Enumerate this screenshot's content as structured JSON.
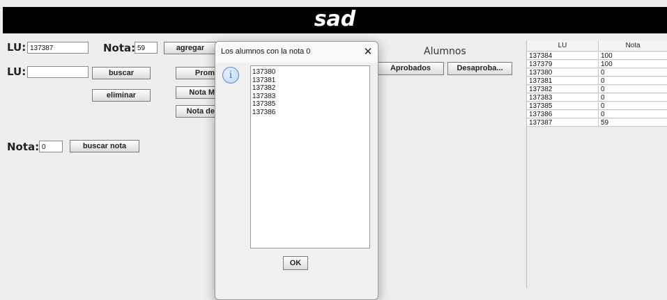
{
  "app": {
    "title": "sad"
  },
  "form": {
    "lu_label": "LU:",
    "lu_value": "137387",
    "nota_label": "Nota:",
    "nota_value": "59",
    "agregar_label": "agregar",
    "lu2_label": "LU:",
    "lu2_value": "",
    "buscar_label": "buscar",
    "eliminar_label": "eliminar",
    "promedio_label": "Prom",
    "nota_max_label": "Nota M",
    "nota_de_label": "Nota de",
    "nota3_label": "Nota:",
    "nota3_value": "0",
    "buscar_nota_label": "buscar nota"
  },
  "alumnos": {
    "label": "Alumnos",
    "aprobados_label": "Aprobados",
    "desaprobados_label": "Desaproba..."
  },
  "table": {
    "headers": [
      "LU",
      "Nota"
    ],
    "rows": [
      [
        "137384",
        "100"
      ],
      [
        "137379",
        "100"
      ],
      [
        "137380",
        "0"
      ],
      [
        "137381",
        "0"
      ],
      [
        "137382",
        "0"
      ],
      [
        "137383",
        "0"
      ],
      [
        "137385",
        "0"
      ],
      [
        "137386",
        "0"
      ],
      [
        "137387",
        "59"
      ]
    ]
  },
  "dialog": {
    "title": "Los alumnos con la nota 0",
    "close_glyph": "✕",
    "icon_glyph": "i",
    "items": [
      "137380",
      "137381",
      "137382",
      "137383",
      "137385",
      "137386"
    ],
    "ok_label": "OK"
  },
  "icons": {
    "info": "info-icon",
    "close": "close-icon"
  },
  "colors": {
    "title_bar": "#000000",
    "info_icon": "#3b78c8"
  }
}
